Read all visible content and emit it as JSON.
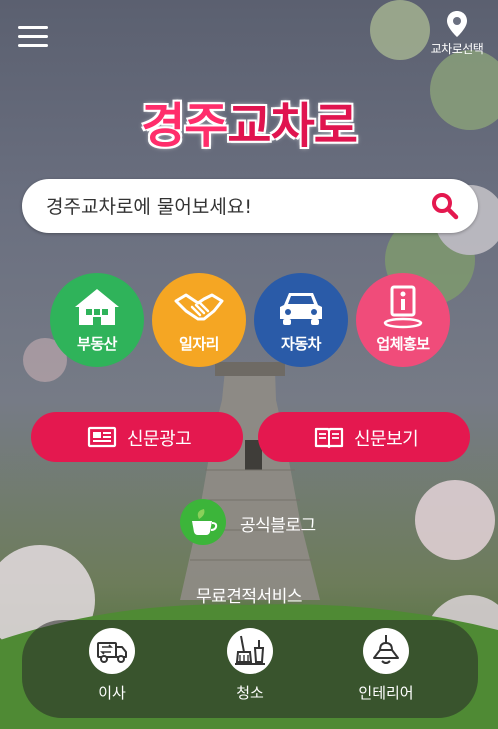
{
  "header": {
    "menu_icon": "hamburger-menu-icon",
    "location_label": "교차로선택",
    "location_icon": "map-pin-icon"
  },
  "logo": {
    "part1": "경주",
    "part2": "교차로"
  },
  "search": {
    "placeholder": "경주교차로에 물어보세요!",
    "icon": "search-icon"
  },
  "categories": [
    {
      "label": "부동산",
      "icon": "house-icon",
      "color": "#2fb35a"
    },
    {
      "label": "일자리",
      "icon": "handshake-icon",
      "color": "#f5a623"
    },
    {
      "label": "자동차",
      "icon": "car-icon",
      "color": "#2a5ba8"
    },
    {
      "label": "업체홍보",
      "icon": "info-board-icon",
      "color": "#f04c7a"
    }
  ],
  "actions": [
    {
      "label": "신문광고",
      "icon": "newspaper-icon"
    },
    {
      "label": "신문보기",
      "icon": "open-book-icon"
    }
  ],
  "blog": {
    "label": "공식블로그",
    "icon": "blog-cup-icon"
  },
  "services_title": "무료견적서비스",
  "services": [
    {
      "label": "이사",
      "icon": "moving-truck-icon"
    },
    {
      "label": "청소",
      "icon": "cleaning-broom-icon"
    },
    {
      "label": "인테리어",
      "icon": "pendant-lamp-icon"
    }
  ],
  "colors": {
    "brand_pink": "#e4184f",
    "logo_pink": "#ff2d6b"
  }
}
